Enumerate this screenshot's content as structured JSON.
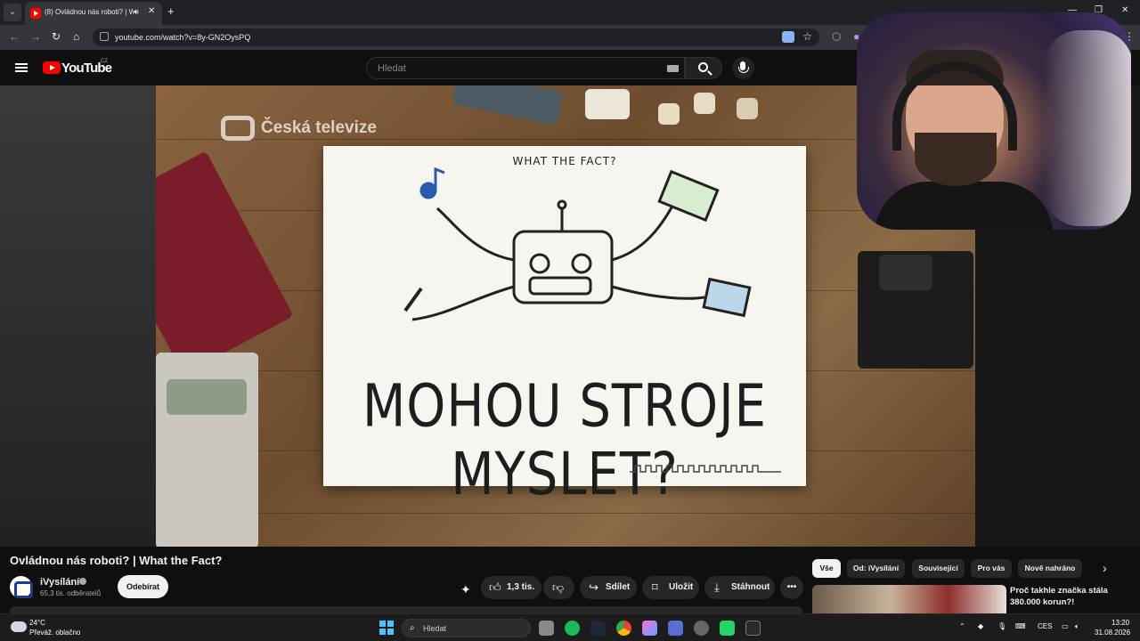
{
  "browser": {
    "tab_title": "(8) Ovládnou nás roboti? | W",
    "url": "youtube.com/watch?v=8y-GN2OysPQ"
  },
  "youtube": {
    "logo_text": "YouTube",
    "country_code": "CZ",
    "search_placeholder": "Hledat"
  },
  "video": {
    "broadcaster_logo": "Česká televize",
    "paper_caption": "WHAT THE FACT?",
    "headline": "MOHOU STROJE MYSLET?",
    "title": "Ovládnou nás roboti? | What the Fact?"
  },
  "channel": {
    "name": "iVysílání",
    "subscribers": "65,3 tis. odběratelů",
    "subscribe_label": "Odebírat"
  },
  "actions": {
    "likes": "1,3 tis.",
    "share": "Sdílet",
    "save": "Uložit",
    "download": "Stáhnout"
  },
  "chips": [
    "Vše",
    "Od: iVysílání",
    "Související",
    "Pro vás",
    "Nově nahráno"
  ],
  "recommendation": {
    "title": "Proč takhle značka stála 380.000 korun?!"
  },
  "taskbar": {
    "temperature": "24°C",
    "weather": "Převáž. oblačno",
    "search_placeholder": "Hledat",
    "language": "CES",
    "time": "13:20",
    "date": "31.08.2026"
  },
  "colors": {
    "youtube_red": "#ff0000",
    "windows_accent": "#4cc2ff"
  }
}
